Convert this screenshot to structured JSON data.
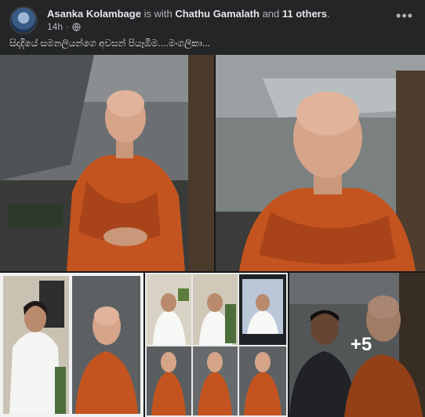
{
  "post": {
    "author": "Asanka Kolambage",
    "with_text": "is with",
    "tagged": "Chathu Gamalath",
    "and_text": "and",
    "others": "11 others",
    "period": ".",
    "time": "14h",
    "time_sep": "·",
    "caption": "සිදාදියේ සමනලියන්ගෙ අවසන් පියෑඹීම....මංගලිකා...",
    "more_photos_count": "+5"
  },
  "icons": {
    "avatar": "profile-avatar",
    "privacy": "globe-icon",
    "menu": "more-horizontal-icon"
  },
  "colors": {
    "background": "#242526",
    "robe": "#c4541f",
    "text_primary": "#e4e6eb",
    "text_secondary": "#b0b3b8"
  }
}
